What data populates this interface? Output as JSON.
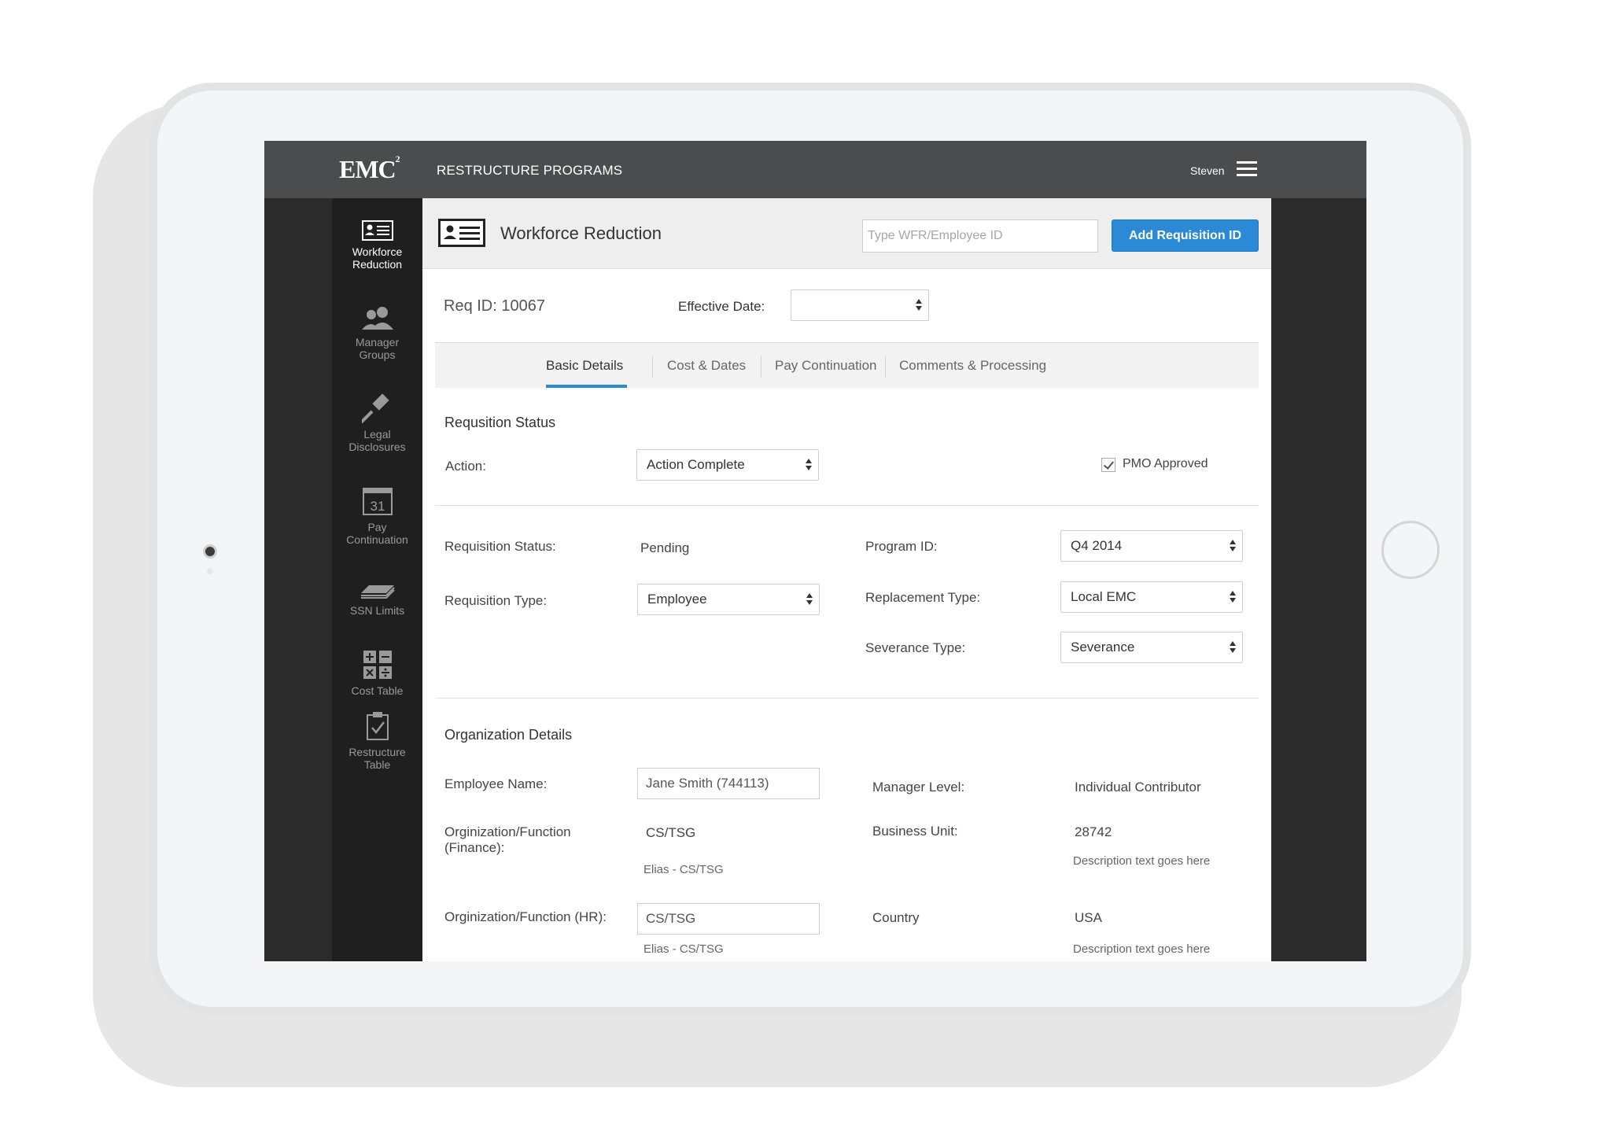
{
  "header": {
    "logo_text": "EMC",
    "logo_sup": "2",
    "app_title": "RESTRUCTURE PROGRAMS",
    "user_name": "Steven"
  },
  "sidebar": {
    "items": [
      {
        "label_line1": "Workforce",
        "label_line2": "Reduction",
        "icon": "id-card-icon",
        "active": true
      },
      {
        "label_line1": "Manager",
        "label_line2": "Groups",
        "icon": "users-icon",
        "active": false
      },
      {
        "label_line1": "Legal",
        "label_line2": "Disclosures",
        "icon": "gavel-icon",
        "active": false
      },
      {
        "label_line1": "Pay",
        "label_line2": "Continuation",
        "icon": "calendar-icon",
        "active": false,
        "calendar_day": "31"
      },
      {
        "label_line1": "SSN Limits",
        "label_line2": "",
        "icon": "money-stack-icon",
        "active": false
      },
      {
        "label_line1": "Cost Table",
        "label_line2": "",
        "icon": "calculator-icon",
        "active": false
      },
      {
        "label_line1": "Restructure",
        "label_line2": "Table",
        "icon": "clipboard-check-icon",
        "active": false
      }
    ]
  },
  "page": {
    "title": "Workforce Reduction",
    "search_placeholder": "Type WFR/Employee ID",
    "add_button": "Add Requisition ID",
    "req_id": "Req ID: 10067",
    "effective_date_label": "Effective Date:",
    "effective_date_value": ""
  },
  "tabs": [
    {
      "label": "Basic Details",
      "active": true
    },
    {
      "label": "Cost & Dates",
      "active": false
    },
    {
      "label": "Pay Continuation",
      "active": false
    },
    {
      "label": "Comments & Processing",
      "active": false
    }
  ],
  "status_section": {
    "title": "Requsition Status",
    "action_label": "Action:",
    "action_value": "Action Complete",
    "pmo_label": "PMO Approved",
    "pmo_checked": true,
    "req_status_label": "Requisition Status:",
    "req_status_value": "Pending",
    "req_type_label": "Requisition Type:",
    "req_type_value": "Employee",
    "program_id_label": "Program ID:",
    "program_id_value": "Q4 2014",
    "replacement_type_label": "Replacement Type:",
    "replacement_type_value": "Local EMC",
    "severance_type_label": "Severance Type:",
    "severance_type_value": "Severance"
  },
  "org_section": {
    "title": "Organization Details",
    "employee_name_label": "Employee Name:",
    "employee_name_value": "Jane Smith (744113)",
    "org_finance_label_1": "Orginization/Function",
    "org_finance_label_2": "(Finance):",
    "org_finance_value": "CS/TSG",
    "org_finance_desc": "Elias - CS/TSG",
    "org_hr_label": "Orginization/Function (HR):",
    "org_hr_value": "CS/TSG",
    "org_hr_desc": "Elias - CS/TSG",
    "manager_level_label": "Manager Level:",
    "manager_level_value": "Individual Contributor",
    "business_unit_label": "Business Unit:",
    "business_unit_value": "28742",
    "business_unit_desc": "Description text goes here",
    "country_label": "Country",
    "country_value": "USA",
    "country_desc": "Description text goes here"
  },
  "colors": {
    "accent": "#2a8ad8",
    "topbar": "#4b4c4e",
    "sidebar": "#1f1f1f"
  }
}
